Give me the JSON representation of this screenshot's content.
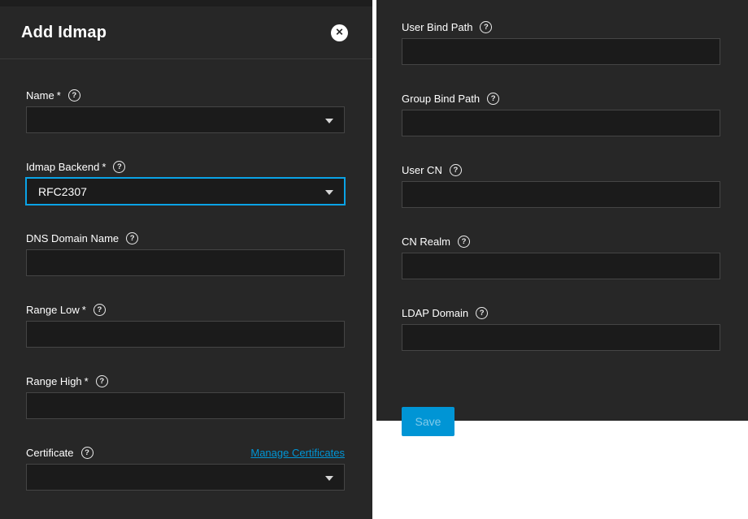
{
  "colors": {
    "accent": "#0095d5",
    "focus_border": "#0aa3e6",
    "panel_bg": "#272727",
    "input_bg": "#1b1b1b",
    "link": "#0095d5"
  },
  "icons": {
    "close": "circled-x",
    "help": "circled-question-mark",
    "select_arrow": "triangle-down"
  },
  "dialog": {
    "title": "Add Idmap",
    "close_glyph": "✕"
  },
  "left_panel": {
    "fields": [
      {
        "label": "Name",
        "required": true,
        "type": "select",
        "value": "",
        "focused": false
      },
      {
        "label": "Idmap Backend",
        "required": true,
        "type": "select",
        "value": "RFC2307",
        "focused": true
      },
      {
        "label": "DNS Domain Name",
        "required": false,
        "type": "text",
        "value": ""
      },
      {
        "label": "Range Low",
        "required": true,
        "type": "text",
        "value": ""
      },
      {
        "label": "Range High",
        "required": true,
        "type": "text",
        "value": ""
      },
      {
        "label": "Certificate",
        "required": false,
        "type": "select",
        "value": "",
        "focused": false,
        "link": "Manage Certificates",
        "extra_gap": true
      }
    ]
  },
  "right_panel": {
    "fields": [
      {
        "label": "User Bind Path",
        "required": false,
        "type": "text",
        "value": ""
      },
      {
        "label": "Group Bind Path",
        "required": false,
        "type": "text",
        "value": ""
      },
      {
        "label": "User CN",
        "required": false,
        "type": "text",
        "value": ""
      },
      {
        "label": "CN Realm",
        "required": false,
        "type": "text",
        "value": ""
      },
      {
        "label": "LDAP Domain",
        "required": false,
        "type": "text",
        "value": ""
      }
    ],
    "save_label": "Save",
    "save_disabled": true
  }
}
